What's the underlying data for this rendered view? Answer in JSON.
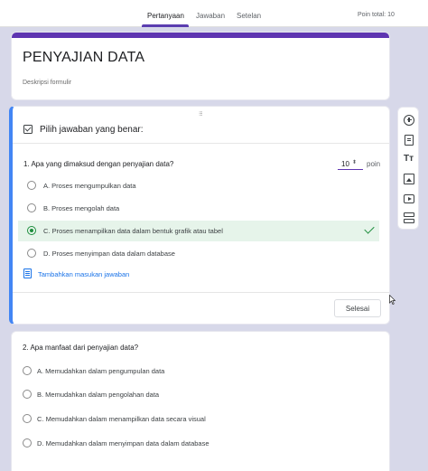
{
  "header": {
    "tabs": [
      {
        "label": "Pertanyaan",
        "active": true
      },
      {
        "label": "Jawaban",
        "active": false
      },
      {
        "label": "Setelan",
        "active": false
      }
    ],
    "total_points": "Poin total: 10"
  },
  "form": {
    "title": "PENYAJIAN DATA",
    "description": "Deskripsi formulir"
  },
  "question1": {
    "section_label": "Pilih jawaban yang benar:",
    "text": "1. Apa yang dimaksud dengan penyajian data?",
    "points_value": "10",
    "points_label": "poin",
    "options": [
      {
        "label": "A. Proses mengumpulkan data",
        "selected": false
      },
      {
        "label": "B. Proses mengolah data",
        "selected": false
      },
      {
        "label": "C. Proses menampilkan data dalam bentuk grafik atau tabel",
        "selected": true
      },
      {
        "label": "D. Proses menyimpan data dalam database",
        "selected": false
      }
    ],
    "feedback_link": "Tambahkan masukan jawaban",
    "done_button": "Selesai"
  },
  "question2": {
    "text": "2. Apa manfaat dari penyajian data?",
    "options": [
      {
        "label": "A. Memudahkan dalam pengumpulan data"
      },
      {
        "label": "B. Memudahkan dalam pengolahan data"
      },
      {
        "label": "C. Memudahkan dalam menampilkan data secara visual"
      },
      {
        "label": "D. Memudahkan dalam menyimpan data dalam database"
      }
    ]
  },
  "toolbar": {
    "items": [
      "add-question-icon",
      "import-questions-icon",
      "add-title-icon",
      "add-image-icon",
      "add-video-icon",
      "add-section-icon"
    ],
    "title_glyph": "Tт"
  },
  "colors": {
    "theme": "#5e35b1",
    "active_border": "#4285f4",
    "correct": "#1e8e3e",
    "correct_bg": "#e6f4ea",
    "link": "#1a73e8"
  }
}
